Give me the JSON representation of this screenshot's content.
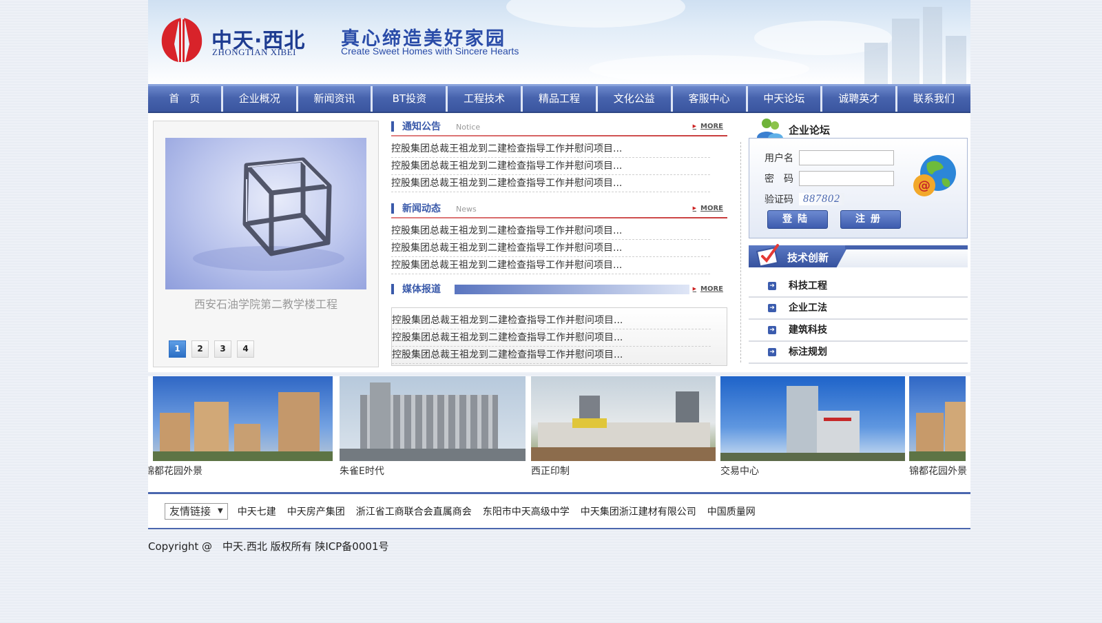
{
  "header": {
    "logo_cn": "中天·西北",
    "logo_en": "ZHONGTIAN XIBEI",
    "slogan_cn": "真心缔造美好家园",
    "slogan_en": "Create Sweet Homes with Sincere Hearts"
  },
  "nav": [
    "首　页",
    "企业概况",
    "新闻资讯",
    "BT投资",
    "工程技术",
    "精品工程",
    "文化公益",
    "客服中心",
    "中天论坛",
    "诚聘英才",
    "联系我们"
  ],
  "slider": {
    "caption": "西安石油学院第二教学楼工程",
    "pages": [
      "1",
      "2",
      "3",
      "4"
    ],
    "active": 0
  },
  "sections": {
    "notice": {
      "title": "通知公告",
      "en": "Notice",
      "more": "MORE",
      "items": [
        "控股集团总裁王祖龙到二建检查指导工作并慰问项目...",
        "控股集团总裁王祖龙到二建检查指导工作并慰问项目...",
        "控股集团总裁王祖龙到二建检查指导工作并慰问项目..."
      ]
    },
    "news": {
      "title": "新闻动态",
      "en": "News",
      "more": "MORE",
      "items": [
        "控股集团总裁王祖龙到二建检查指导工作并慰问项目...",
        "控股集团总裁王祖龙到二建检查指导工作并慰问项目...",
        "控股集团总裁王祖龙到二建检查指导工作并慰问项目..."
      ]
    },
    "media": {
      "title": "媒体报道",
      "more": "MORE",
      "items": [
        "控股集团总裁王祖龙到二建检查指导工作并慰问项目...",
        "控股集团总裁王祖龙到二建检查指导工作并慰问项目...",
        "控股集团总裁王祖龙到二建检查指导工作并慰问项目..."
      ]
    }
  },
  "forum": {
    "title": "企业论坛",
    "username_label": "用户名",
    "password_label": "密　码",
    "captcha_label": "验证码",
    "captcha_value": "887802",
    "login_button": "登陆",
    "register_button": "注册"
  },
  "tech": {
    "title": "技术创新",
    "items": [
      "科技工程",
      "企业工法",
      "建筑科技",
      "标注规划"
    ]
  },
  "photos": [
    {
      "caption": "锦都花园外景"
    },
    {
      "caption": "朱雀E时代"
    },
    {
      "caption": "西正印制"
    },
    {
      "caption": "交易中心"
    },
    {
      "caption": "锦都花园外景"
    }
  ],
  "links": {
    "select_label": "友情链接",
    "items": [
      "中天七建",
      "中天房产集团",
      "浙江省工商联合会直属商会",
      "东阳市中天高级中学",
      "中天集团浙江建材有限公司",
      "中国质量网"
    ]
  },
  "footer": {
    "copyright": "Copyright @　中天.西北 版权所有 陕ICP备0001号"
  },
  "colors": {
    "nav_blue": "#4763ad",
    "title_blue": "#3a5aaa",
    "accent_red": "#cc2222"
  }
}
